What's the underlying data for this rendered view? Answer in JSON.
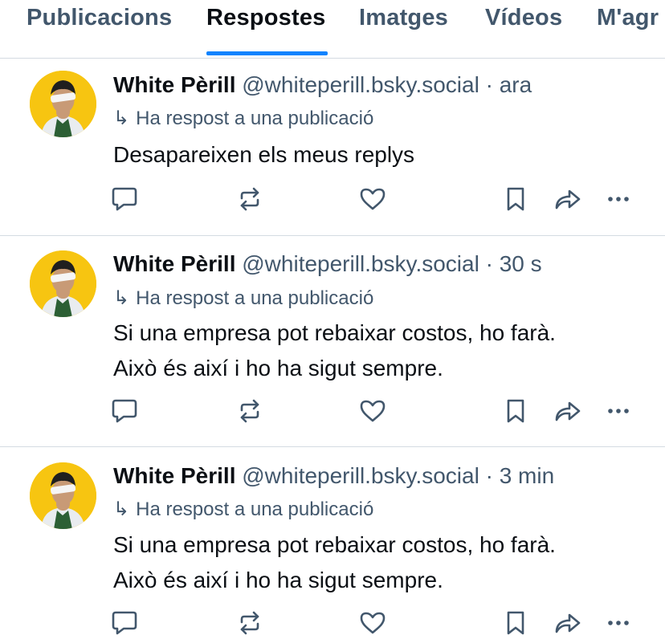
{
  "tabs": [
    {
      "label": "Publicacions",
      "active": false
    },
    {
      "label": "Respostes",
      "active": true
    },
    {
      "label": "Imatges",
      "active": false
    },
    {
      "label": "Vídeos",
      "active": false
    },
    {
      "label": "M'agr",
      "active": false
    }
  ],
  "colors": {
    "accent": "#1083fe",
    "muted": "#42576c",
    "avatar_bg": "#f7c511"
  },
  "posts": [
    {
      "author": "White Pèrill",
      "handle": "@whiteperill.bsky.social",
      "separator": "·",
      "time": "ara",
      "reply_arrow": "↳",
      "reply_note": "Ha respost a una publicació",
      "lines": [
        "Desapareixen els meus replys"
      ],
      "actions": [
        "reply-icon",
        "repost-icon",
        "like-icon",
        "bookmark-icon",
        "share-icon",
        "more-icon"
      ]
    },
    {
      "author": "White Pèrill",
      "handle": "@whiteperill.bsky.social",
      "separator": "·",
      "time": "30 s",
      "reply_arrow": "↳",
      "reply_note": "Ha respost a una publicació",
      "lines": [
        "Si una empresa pot rebaixar costos, ho farà.",
        "Això és així i ho ha sigut sempre."
      ],
      "actions": [
        "reply-icon",
        "repost-icon",
        "like-icon",
        "bookmark-icon",
        "share-icon",
        "more-icon"
      ]
    },
    {
      "author": "White Pèrill",
      "handle": "@whiteperill.bsky.social",
      "separator": "·",
      "time": "3 min",
      "reply_arrow": "↳",
      "reply_note": "Ha respost a una publicació",
      "lines": [
        "Si una empresa pot rebaixar costos, ho farà.",
        "Això és així i ho ha sigut sempre."
      ],
      "actions": [
        "reply-icon",
        "repost-icon",
        "like-icon",
        "bookmark-icon",
        "share-icon",
        "more-icon"
      ]
    }
  ]
}
